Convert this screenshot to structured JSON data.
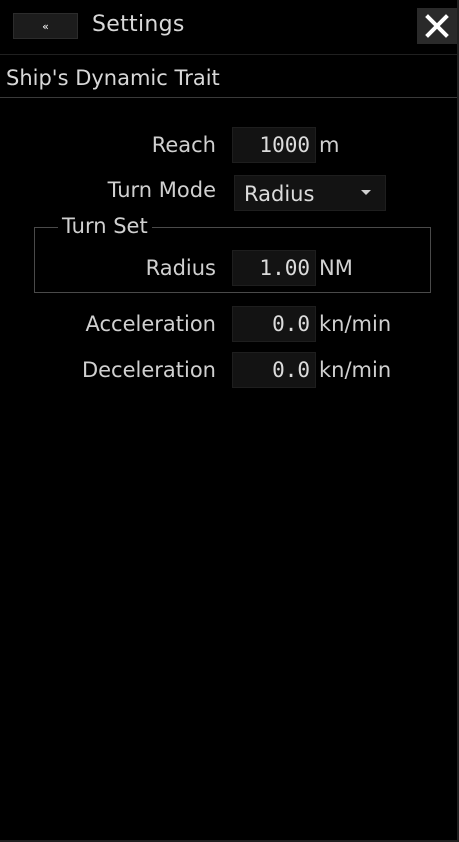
{
  "header": {
    "back_glyph": "«",
    "title": "Settings",
    "close_glyph": "✕"
  },
  "section": {
    "title": "Ship's Dynamic Trait"
  },
  "form": {
    "reach": {
      "label": "Reach",
      "value": "1000",
      "unit": "m"
    },
    "turn_mode": {
      "label": "Turn Mode",
      "value": "Radius"
    },
    "turn_set": {
      "legend": "Turn Set",
      "radius": {
        "label": "Radius",
        "value": "1.00",
        "unit": "NM"
      }
    },
    "acceleration": {
      "label": "Acceleration",
      "value": "0.0",
      "unit": "kn/min"
    },
    "deceleration": {
      "label": "Deceleration",
      "value": "0.0",
      "unit": "kn/min"
    }
  },
  "colors": {
    "background": "#000000",
    "text": "#d8d8d8",
    "field_bg": "#131313",
    "button_bg": "#2a2a2a"
  }
}
